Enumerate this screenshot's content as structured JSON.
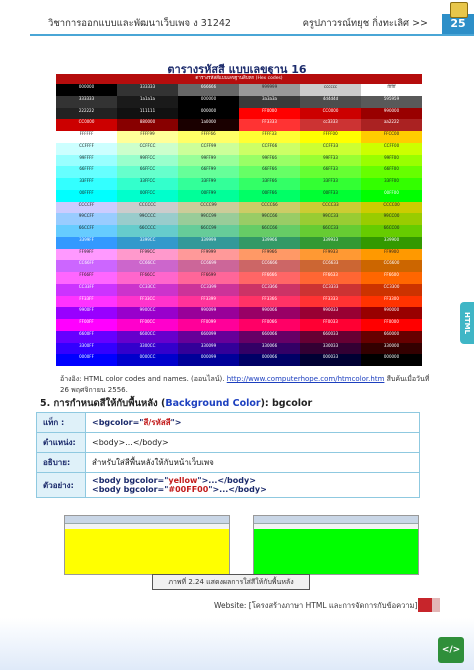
{
  "header": {
    "left": "วิชาการออกแบบและพัฒนาเว็บเพจ ง 31242",
    "right": "ครูปภาวรณ์ทยุช กิ่งทะเลิศ >>",
    "page": "25"
  },
  "side_tab": "HTML",
  "chart": {
    "title": "ตารางรหัสสี แบบเลขฐาน 16",
    "head": "ตารางรหัสสีแบบเลขฐานสิบหก (Hex codes)",
    "rows": [
      [
        "#000000",
        "#333333",
        "#666666",
        "#999999",
        "#cccccc",
        "#ffffff"
      ],
      [
        "333333",
        "#1a1a1a",
        "000000",
        "#3a3a3a",
        "#4d4d4d",
        "#595959"
      ],
      [
        "222222",
        "111111",
        "000000",
        "FF0000",
        "CC0000",
        "990000"
      ],
      [
        "CC0000",
        "880000",
        "#1a0000",
        "FF3333",
        "#cc3333",
        "#aa2222"
      ],
      [
        "FFFFFF",
        "FFFF99",
        "FFFF66",
        "FFFF33",
        "FFFF00",
        "FFCC00"
      ],
      [
        "CCFFFF",
        "CCFFCC",
        "CCFF99",
        "CCFF66",
        "CCFF33",
        "CCFF00"
      ],
      [
        "99FFFF",
        "99FFCC",
        "99FF99",
        "99FF66",
        "99FF33",
        "99FF00"
      ],
      [
        "66FFFF",
        "66FFCC",
        "66FF99",
        "66FF66",
        "66FF33",
        "66FF00"
      ],
      [
        "33FFFF",
        "33FFCC",
        "33FF99",
        "33FF66",
        "33FF33",
        "33FF00"
      ],
      [
        "00FFFF",
        "00FFCC",
        "00FF99",
        "00FF66",
        "00FF33",
        "00FF00"
      ],
      [
        "CCCCFF",
        "CCCCCC",
        "CCCC99",
        "CCCC66",
        "CCCC33",
        "CCCC00"
      ],
      [
        "99CCFF",
        "99CCCC",
        "99CC99",
        "99CC66",
        "99CC33",
        "99CC00"
      ],
      [
        "66CCFF",
        "66CCCC",
        "66CC99",
        "66CC66",
        "66CC33",
        "66CC00"
      ],
      [
        "3399FF",
        "3399CC",
        "339999",
        "339966",
        "339933",
        "339900"
      ],
      [
        "FF99FF",
        "FF99CC",
        "FF9999",
        "FF9966",
        "FF9933",
        "FF9900"
      ],
      [
        "CC66FF",
        "CC66CC",
        "CC6699",
        "CC6666",
        "CC6633",
        "CC6600"
      ],
      [
        "FF66FF",
        "FF66CC",
        "FF6699",
        "FF6666",
        "FF6633",
        "FF6600"
      ],
      [
        "CC33FF",
        "CC33CC",
        "CC3399",
        "CC3366",
        "CC3333",
        "CC3300"
      ],
      [
        "FF33FF",
        "FF33CC",
        "FF3399",
        "FF3366",
        "FF3333",
        "FF3300"
      ],
      [
        "9900FF",
        "9900CC",
        "990099",
        "990066",
        "990033",
        "990000"
      ],
      [
        "FF00FF",
        "FF00CC",
        "FF0099",
        "FF0066",
        "FF0033",
        "FF0000"
      ],
      [
        "6600FF",
        "6600CC",
        "660099",
        "660066",
        "660033",
        "660000"
      ],
      [
        "3300FF",
        "3300CC",
        "330099",
        "330066",
        "330033",
        "330000"
      ],
      [
        "0000FF",
        "0000CC",
        "000099",
        "000066",
        "000033",
        "000000"
      ]
    ]
  },
  "source": {
    "text": "อ้างอิง: HTML color codes and names. (ออนไลน์). ",
    "link": "http://www.computerhope.com/htmcolor.htm",
    "after": " สืบค้นเมื่อวันที่ 26 พฤศจิกายน 2556."
  },
  "section": {
    "num": "5. การกำหนดสีให้กับพื้นหลัง (",
    "eng": "Background Color",
    "tail": "): bgcolor"
  },
  "info_table": {
    "k1": "แท็ก :",
    "v1a": "<bgcolor=\"",
    "v1b": "สี/รหัสสี",
    "v1c": "\">",
    "k2": "ตำแหน่ง:",
    "v2": "<body>...</body>",
    "k3": "อธิบาย:",
    "v3": "สำหรับใส่สีพื้นหลังให้กับหน้าเว็บเพจ",
    "k4": "ตัวอย่าง:",
    "ex1a": "<body bgcolor=\"",
    "ex1b": "yellow",
    "ex1c": "\">...</body>",
    "ex2a": "<body bgcolor=\"",
    "ex2b": "#00FF00",
    "ex2c": "\">...</body>"
  },
  "caption": "ภาพที่ 2.24 แสดงผลการใส่สีให้กับพื้นหลัง",
  "website": "Website: [โครงสร้างภาษา HTML และการจัดการกับข้อความ] |",
  "colors": {
    "yellow": "#ffff00",
    "green": "#00ff00",
    "accent": "#2d8fc8"
  },
  "icons": {
    "corner": "book-icon",
    "footer": "code-file-icon"
  }
}
